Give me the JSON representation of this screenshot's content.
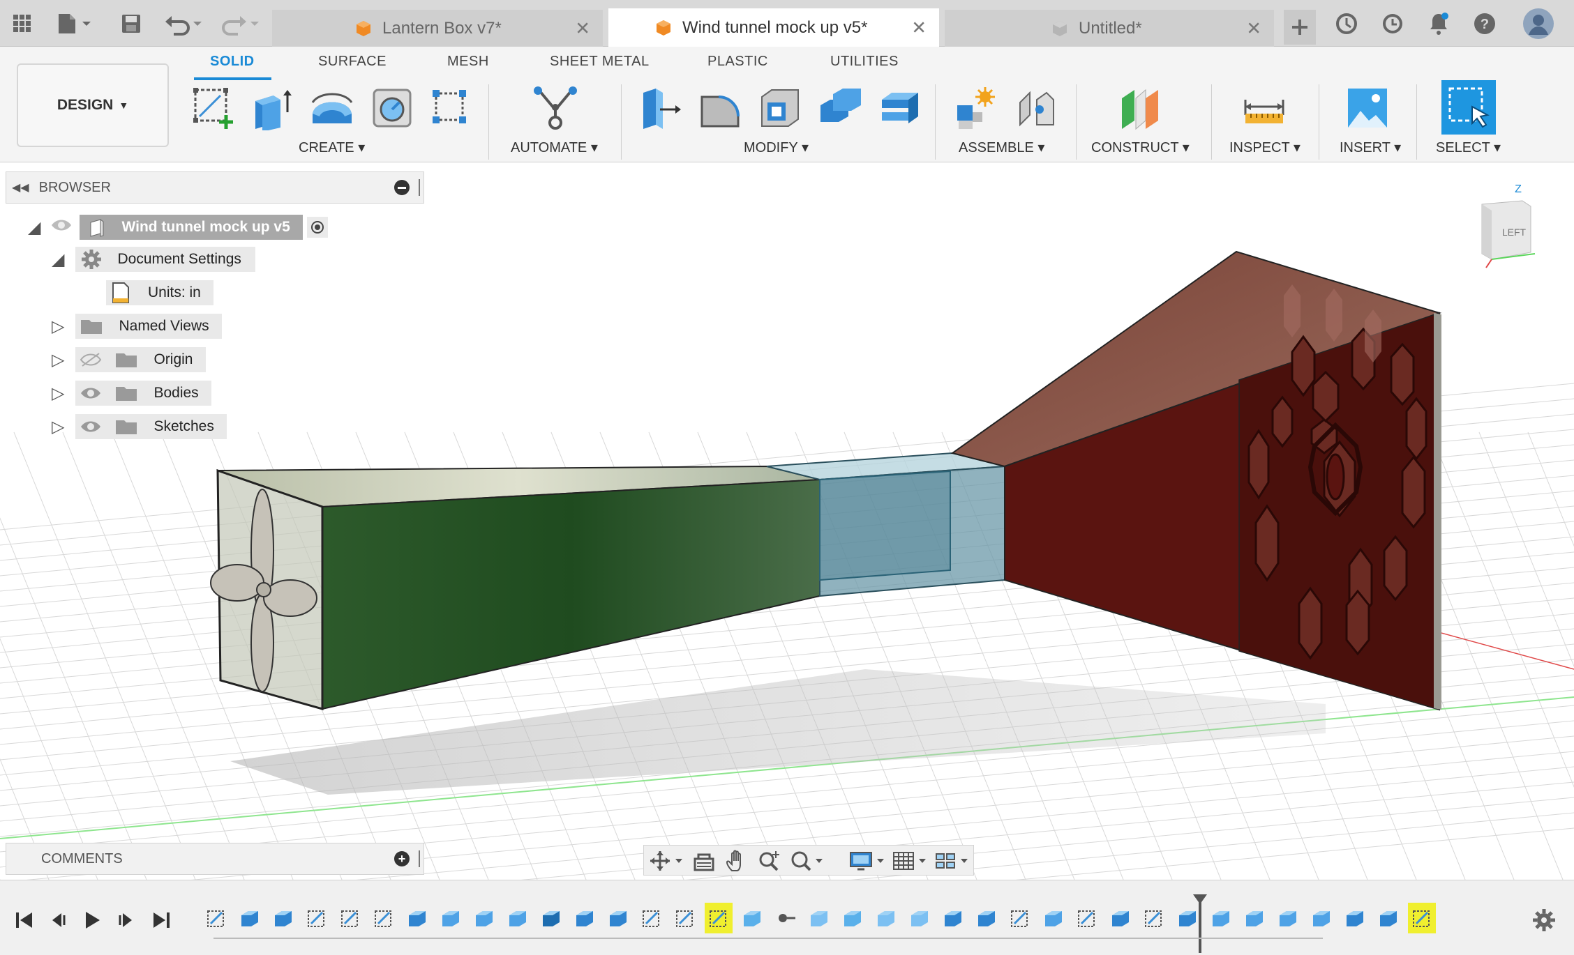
{
  "colors": {
    "accent": "#1a8ad6",
    "highlight": "#f0ef2f",
    "tab_bar": "#d9d9d9",
    "ribbon": "#f4f4f4"
  },
  "topbar": {
    "icons": [
      "apps-grid-icon",
      "file-menu-icon",
      "save-icon",
      "undo-icon",
      "redo-icon"
    ],
    "tabs": [
      {
        "title": "Lantern Box v7*",
        "active": false
      },
      {
        "title": "Wind tunnel mock up v5*",
        "active": true
      },
      {
        "title": "Untitled*",
        "active": false
      }
    ],
    "right_icons": [
      "new-tab-icon",
      "job-status-icon",
      "clock-icon",
      "notification-icon",
      "help-icon",
      "profile-avatar"
    ]
  },
  "workspace": {
    "label": "DESIGN"
  },
  "ribbon_tabs": [
    "SOLID",
    "SURFACE",
    "MESH",
    "SHEET METAL",
    "PLASTIC",
    "UTILITIES"
  ],
  "active_ribbon_tab": "SOLID",
  "groups": {
    "create": "CREATE",
    "automate": "AUTOMATE",
    "modify": "MODIFY",
    "assemble": "ASSEMBLE",
    "construct": "CONSTRUCT",
    "inspect": "INSPECT",
    "insert": "INSERT",
    "select": "SELECT"
  },
  "browser": {
    "title": "BROWSER",
    "root": "Wind tunnel mock up v5",
    "items": [
      {
        "label": "Document Settings"
      },
      {
        "label": "Units: in"
      },
      {
        "label": "Named Views"
      },
      {
        "label": "Origin"
      },
      {
        "label": "Bodies"
      },
      {
        "label": "Sketches"
      }
    ]
  },
  "viewcube": {
    "face": "LEFT",
    "axis": "Z"
  },
  "comments": {
    "title": "COMMENTS"
  },
  "navbar": {
    "icons": [
      "orbit-icon",
      "look-at-icon",
      "pan-icon",
      "zoom-icon",
      "fit-icon",
      "display-settings-icon",
      "grid-settings-icon",
      "viewports-icon"
    ]
  },
  "timeline": {
    "features_count": 37,
    "highlighted": [
      15,
      36,
      37,
      38,
      39
    ]
  }
}
